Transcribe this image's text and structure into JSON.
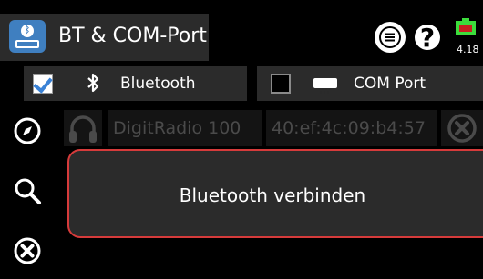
{
  "header": {
    "title": "BT & COM-Port",
    "voltage": "4.18",
    "icons": [
      "bluetooth-app-icon",
      "menu-icon",
      "help-icon",
      "battery-icon"
    ]
  },
  "tabs": [
    {
      "label": "Bluetooth",
      "checked": true,
      "icon": "bluetooth-icon"
    },
    {
      "label": "COM Port",
      "checked": false,
      "icon": "serial-port-icon"
    }
  ],
  "device": {
    "name": "DigitRadio 100",
    "mac": "40:ef:4c:09:b4:57",
    "icons": [
      "headphones-icon",
      "remove-icon"
    ]
  },
  "side_icons": [
    "compass-icon",
    "search-icon",
    "close-icon"
  ],
  "dialog": {
    "message": "Bluetooth verbinden"
  },
  "colors": {
    "panel": "#2b2b2b",
    "accent_blue": "#3a82d6",
    "dialog_border": "#d63b3b",
    "battery_green": "#3cdd3c",
    "disabled_text": "#4a4a4a"
  }
}
